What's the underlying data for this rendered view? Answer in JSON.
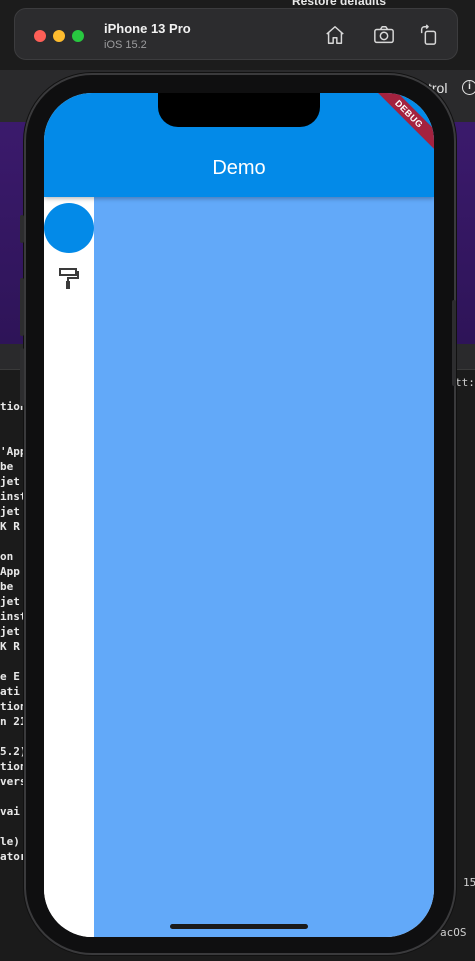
{
  "desktop": {
    "top_text": "Restore defaults",
    "bar_text": "trol",
    "console_lines": [
      "tion",
      "",
      "",
      "'App",
      "be",
      "jet",
      "inst",
      "jet",
      "K R",
      "",
      "on",
      "App",
      "be",
      "jet",
      "inst",
      "jet",
      "K R",
      "",
      "e E",
      "ati",
      "tion",
      "n 21",
      "",
      "5.2)",
      "tion",
      "vers",
      "",
      "vai",
      "",
      "le)",
      "ator"
    ],
    "console_right_top": "tt:/",
    "console_right_mid": "15",
    "console_right_bottom": "acOS"
  },
  "simulator": {
    "device_name": "iPhone 13 Pro",
    "os_version": "iOS 15.2",
    "icons": [
      "home-icon",
      "screenshot-icon",
      "rotate-icon"
    ]
  },
  "app": {
    "title": "Demo",
    "debug_label": "DEBUG",
    "colors": {
      "app_bar": "#038ae8",
      "content": "#62a9f9",
      "rail": "#ffffff",
      "avatar": "#038ae8"
    },
    "rail_icons": [
      "paint-roller-icon"
    ]
  }
}
